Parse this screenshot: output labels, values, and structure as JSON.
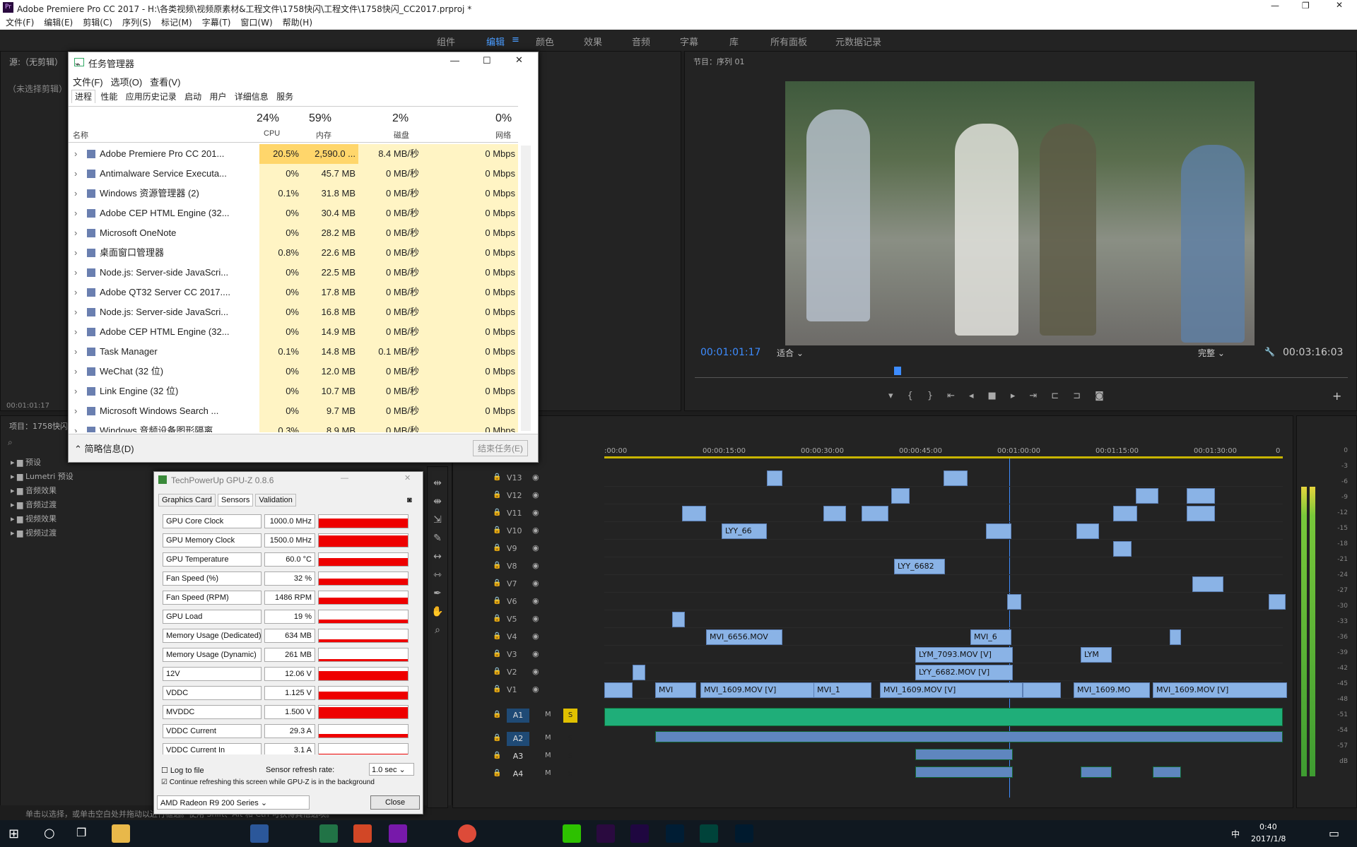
{
  "app": {
    "title": "Adobe Premiere Pro CC 2017 - H:\\各类视频\\视频原素材&工程文件\\1758快闪\\工程文件\\1758快闪_CC2017.prproj *",
    "menus": [
      "文件(F)",
      "编辑(E)",
      "剪辑(C)",
      "序列(S)",
      "标记(M)",
      "字幕(T)",
      "窗口(W)",
      "帮助(H)"
    ],
    "workspaces": [
      "组件",
      "编辑",
      "颜色",
      "效果",
      "音频",
      "字幕",
      "库",
      "所有面板",
      "元数据记录"
    ],
    "source_label": "源:（无剪辑）",
    "no_clip": "（未选择剪辑）",
    "source_time": "00:01:01:17",
    "project_label": "项目：1758快闪",
    "effects": [
      "预设",
      "Lumetri 预设",
      "音频效果",
      "音频过渡",
      "视频效果",
      "视频过渡"
    ],
    "status": "单击以选择，或单击空白处并拖动以进行框选。使用 Shift、Alt 和 Ctrl 可获得其他选项。"
  },
  "program": {
    "label": "节目：序列 01",
    "timecode": "00:01:01:17",
    "fit": "适合",
    "quality": "完整",
    "duration": "00:03:16:03"
  },
  "timeline": {
    "ruler": [
      ":00:00",
      "00:00:15:00",
      "00:00:30:00",
      "00:00:45:00",
      "00:01:00:00",
      "00:01:15:00",
      "00:01:30:00",
      "0"
    ],
    "video_tracks": [
      "V13",
      "V12",
      "V11",
      "V10",
      "V9",
      "V8",
      "V7",
      "V6",
      "V5",
      "V4",
      "V3",
      "V2",
      "V1"
    ],
    "audio_tracks": [
      "A1",
      "A2",
      "A3",
      "A4"
    ],
    "clip_labels": [
      "LYY_66",
      "LYY_6682",
      "MVI_6656.MOV",
      "MVI_6",
      "LYM_7093.MOV [V]",
      "LYM",
      "LYY_6682.MOV [V]",
      "MVI_1609.MOV [V]",
      "MVI_1609.MOV [V]",
      "MVI_1609.MO",
      "MVI_1609.MOV [V]",
      "MVI",
      "MVI_1",
      "LYM",
      "MVI"
    ],
    "meter_scale": [
      "0",
      "-3",
      "-6",
      "-9",
      "-12",
      "-15",
      "-18",
      "-21",
      "-24",
      "-27",
      "-30",
      "-33",
      "-36",
      "-39",
      "-42",
      "-45",
      "-48",
      "-51",
      "-54",
      "-57",
      "dB"
    ]
  },
  "task_manager": {
    "title": "任务管理器",
    "menus": [
      "文件(F)",
      "选项(O)",
      "查看(V)"
    ],
    "tabs": [
      "进程",
      "性能",
      "应用历史记录",
      "启动",
      "用户",
      "详细信息",
      "服务"
    ],
    "cols": {
      "name": "名称",
      "cpu_pct": "24%",
      "cpu": "CPU",
      "mem_pct": "59%",
      "mem": "内存",
      "disk_pct": "2%",
      "disk": "磁盘",
      "net_pct": "0%",
      "net": "网络"
    },
    "rows": [
      {
        "name": "Adobe Premiere Pro CC 201...",
        "cpu": "20.5%",
        "mem": "2,590.0 ...",
        "disk": "8.4 MB/秒",
        "net": "0 Mbps"
      },
      {
        "name": "Antimalware Service Executa...",
        "cpu": "0%",
        "mem": "45.7 MB",
        "disk": "0 MB/秒",
        "net": "0 Mbps"
      },
      {
        "name": "Windows 资源管理器 (2)",
        "cpu": "0.1%",
        "mem": "31.8 MB",
        "disk": "0 MB/秒",
        "net": "0 Mbps"
      },
      {
        "name": "Adobe CEP HTML Engine (32...",
        "cpu": "0%",
        "mem": "30.4 MB",
        "disk": "0 MB/秒",
        "net": "0 Mbps"
      },
      {
        "name": "Microsoft OneNote",
        "cpu": "0%",
        "mem": "28.2 MB",
        "disk": "0 MB/秒",
        "net": "0 Mbps"
      },
      {
        "name": "桌面窗口管理器",
        "cpu": "0.8%",
        "mem": "22.6 MB",
        "disk": "0 MB/秒",
        "net": "0 Mbps"
      },
      {
        "name": "Node.js: Server-side JavaScri...",
        "cpu": "0%",
        "mem": "22.5 MB",
        "disk": "0 MB/秒",
        "net": "0 Mbps"
      },
      {
        "name": "Adobe QT32 Server CC 2017....",
        "cpu": "0%",
        "mem": "17.8 MB",
        "disk": "0 MB/秒",
        "net": "0 Mbps"
      },
      {
        "name": "Node.js: Server-side JavaScri...",
        "cpu": "0%",
        "mem": "16.8 MB",
        "disk": "0 MB/秒",
        "net": "0 Mbps"
      },
      {
        "name": "Adobe CEP HTML Engine (32...",
        "cpu": "0%",
        "mem": "14.9 MB",
        "disk": "0 MB/秒",
        "net": "0 Mbps"
      },
      {
        "name": "Task Manager",
        "cpu": "0.1%",
        "mem": "14.8 MB",
        "disk": "0.1 MB/秒",
        "net": "0 Mbps"
      },
      {
        "name": "WeChat (32 位)",
        "cpu": "0%",
        "mem": "12.0 MB",
        "disk": "0 MB/秒",
        "net": "0 Mbps"
      },
      {
        "name": "Link Engine (32 位)",
        "cpu": "0%",
        "mem": "10.7 MB",
        "disk": "0 MB/秒",
        "net": "0 Mbps"
      },
      {
        "name": "Microsoft Windows Search ...",
        "cpu": "0%",
        "mem": "9.7 MB",
        "disk": "0 MB/秒",
        "net": "0 Mbps"
      },
      {
        "name": "Windows 音频设备图形隔离",
        "cpu": "0.3%",
        "mem": "8.9 MB",
        "disk": "0 MB/秒",
        "net": "0 Mbps"
      }
    ],
    "fewer": "简略信息(D)",
    "end_task": "结束任务(E)"
  },
  "gpuz": {
    "title": "TechPowerUp GPU-Z 0.8.6",
    "tabs": [
      "Graphics Card",
      "Sensors",
      "Validation"
    ],
    "sensors": [
      {
        "name": "GPU Core Clock",
        "value": "1000.0 MHz",
        "fill": 0.7
      },
      {
        "name": "GPU Memory Clock",
        "value": "1500.0 MHz",
        "fill": 0.9
      },
      {
        "name": "GPU Temperature",
        "value": "60.0 °C",
        "fill": 0.6
      },
      {
        "name": "Fan Speed (%)",
        "value": "32 %",
        "fill": 0.5
      },
      {
        "name": "Fan Speed (RPM)",
        "value": "1486 RPM",
        "fill": 0.5
      },
      {
        "name": "GPU Load",
        "value": "19 %",
        "fill": 0.3
      },
      {
        "name": "Memory Usage (Dedicated)",
        "value": "634 MB",
        "fill": 0.2
      },
      {
        "name": "Memory Usage (Dynamic)",
        "value": "261 MB",
        "fill": 0.15
      },
      {
        "name": "12V",
        "value": "12.06 V",
        "fill": 0.7
      },
      {
        "name": "VDDC",
        "value": "1.125 V",
        "fill": 0.6
      },
      {
        "name": "MVDDC",
        "value": "1.500 V",
        "fill": 0.9
      },
      {
        "name": "VDDC Current",
        "value": "29.3 A",
        "fill": 0.3
      },
      {
        "name": "VDDC Current In",
        "value": "3.1 A",
        "fill": 0.25
      }
    ],
    "log": "Log to file",
    "refresh_label": "Sensor refresh rate:",
    "refresh": "1.0 sec",
    "continue": "Continue refreshing this screen while GPU-Z is in the background",
    "gpu": "AMD Radeon R9 200 Series",
    "close": "Close"
  },
  "taskbar": {
    "time": "0:40",
    "date": "2017/1/8",
    "ime": "中"
  }
}
